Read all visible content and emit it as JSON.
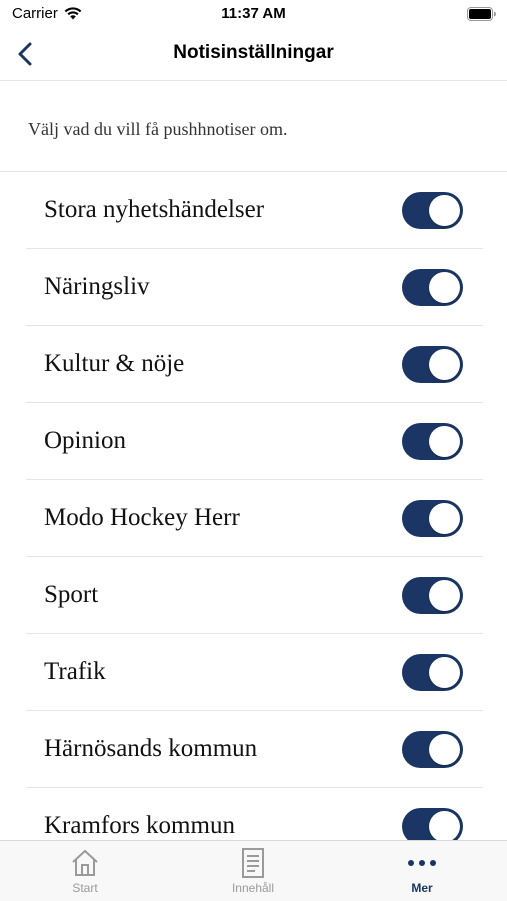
{
  "status_bar": {
    "carrier": "Carrier",
    "time": "11:37 AM"
  },
  "header": {
    "title": "Notisinställningar"
  },
  "intro": {
    "text": "Välj vad du vill få pushhnotiser om."
  },
  "settings": [
    {
      "label": "Stora nyhetshändelser",
      "enabled": true
    },
    {
      "label": "Näringsliv",
      "enabled": true
    },
    {
      "label": "Kultur & nöje",
      "enabled": true
    },
    {
      "label": "Opinion",
      "enabled": true
    },
    {
      "label": "Modo Hockey Herr",
      "enabled": true
    },
    {
      "label": "Sport",
      "enabled": true
    },
    {
      "label": "Trafik",
      "enabled": true
    },
    {
      "label": "Härnösands kommun",
      "enabled": true
    },
    {
      "label": "Kramfors kommun",
      "enabled": true
    }
  ],
  "tab_bar": {
    "start": "Start",
    "contents": "Innehåll",
    "more": "Mer"
  },
  "colors": {
    "accent": "#1b3664",
    "divider": "#e4e4e4",
    "inactive_tab": "#9a9a9a"
  }
}
